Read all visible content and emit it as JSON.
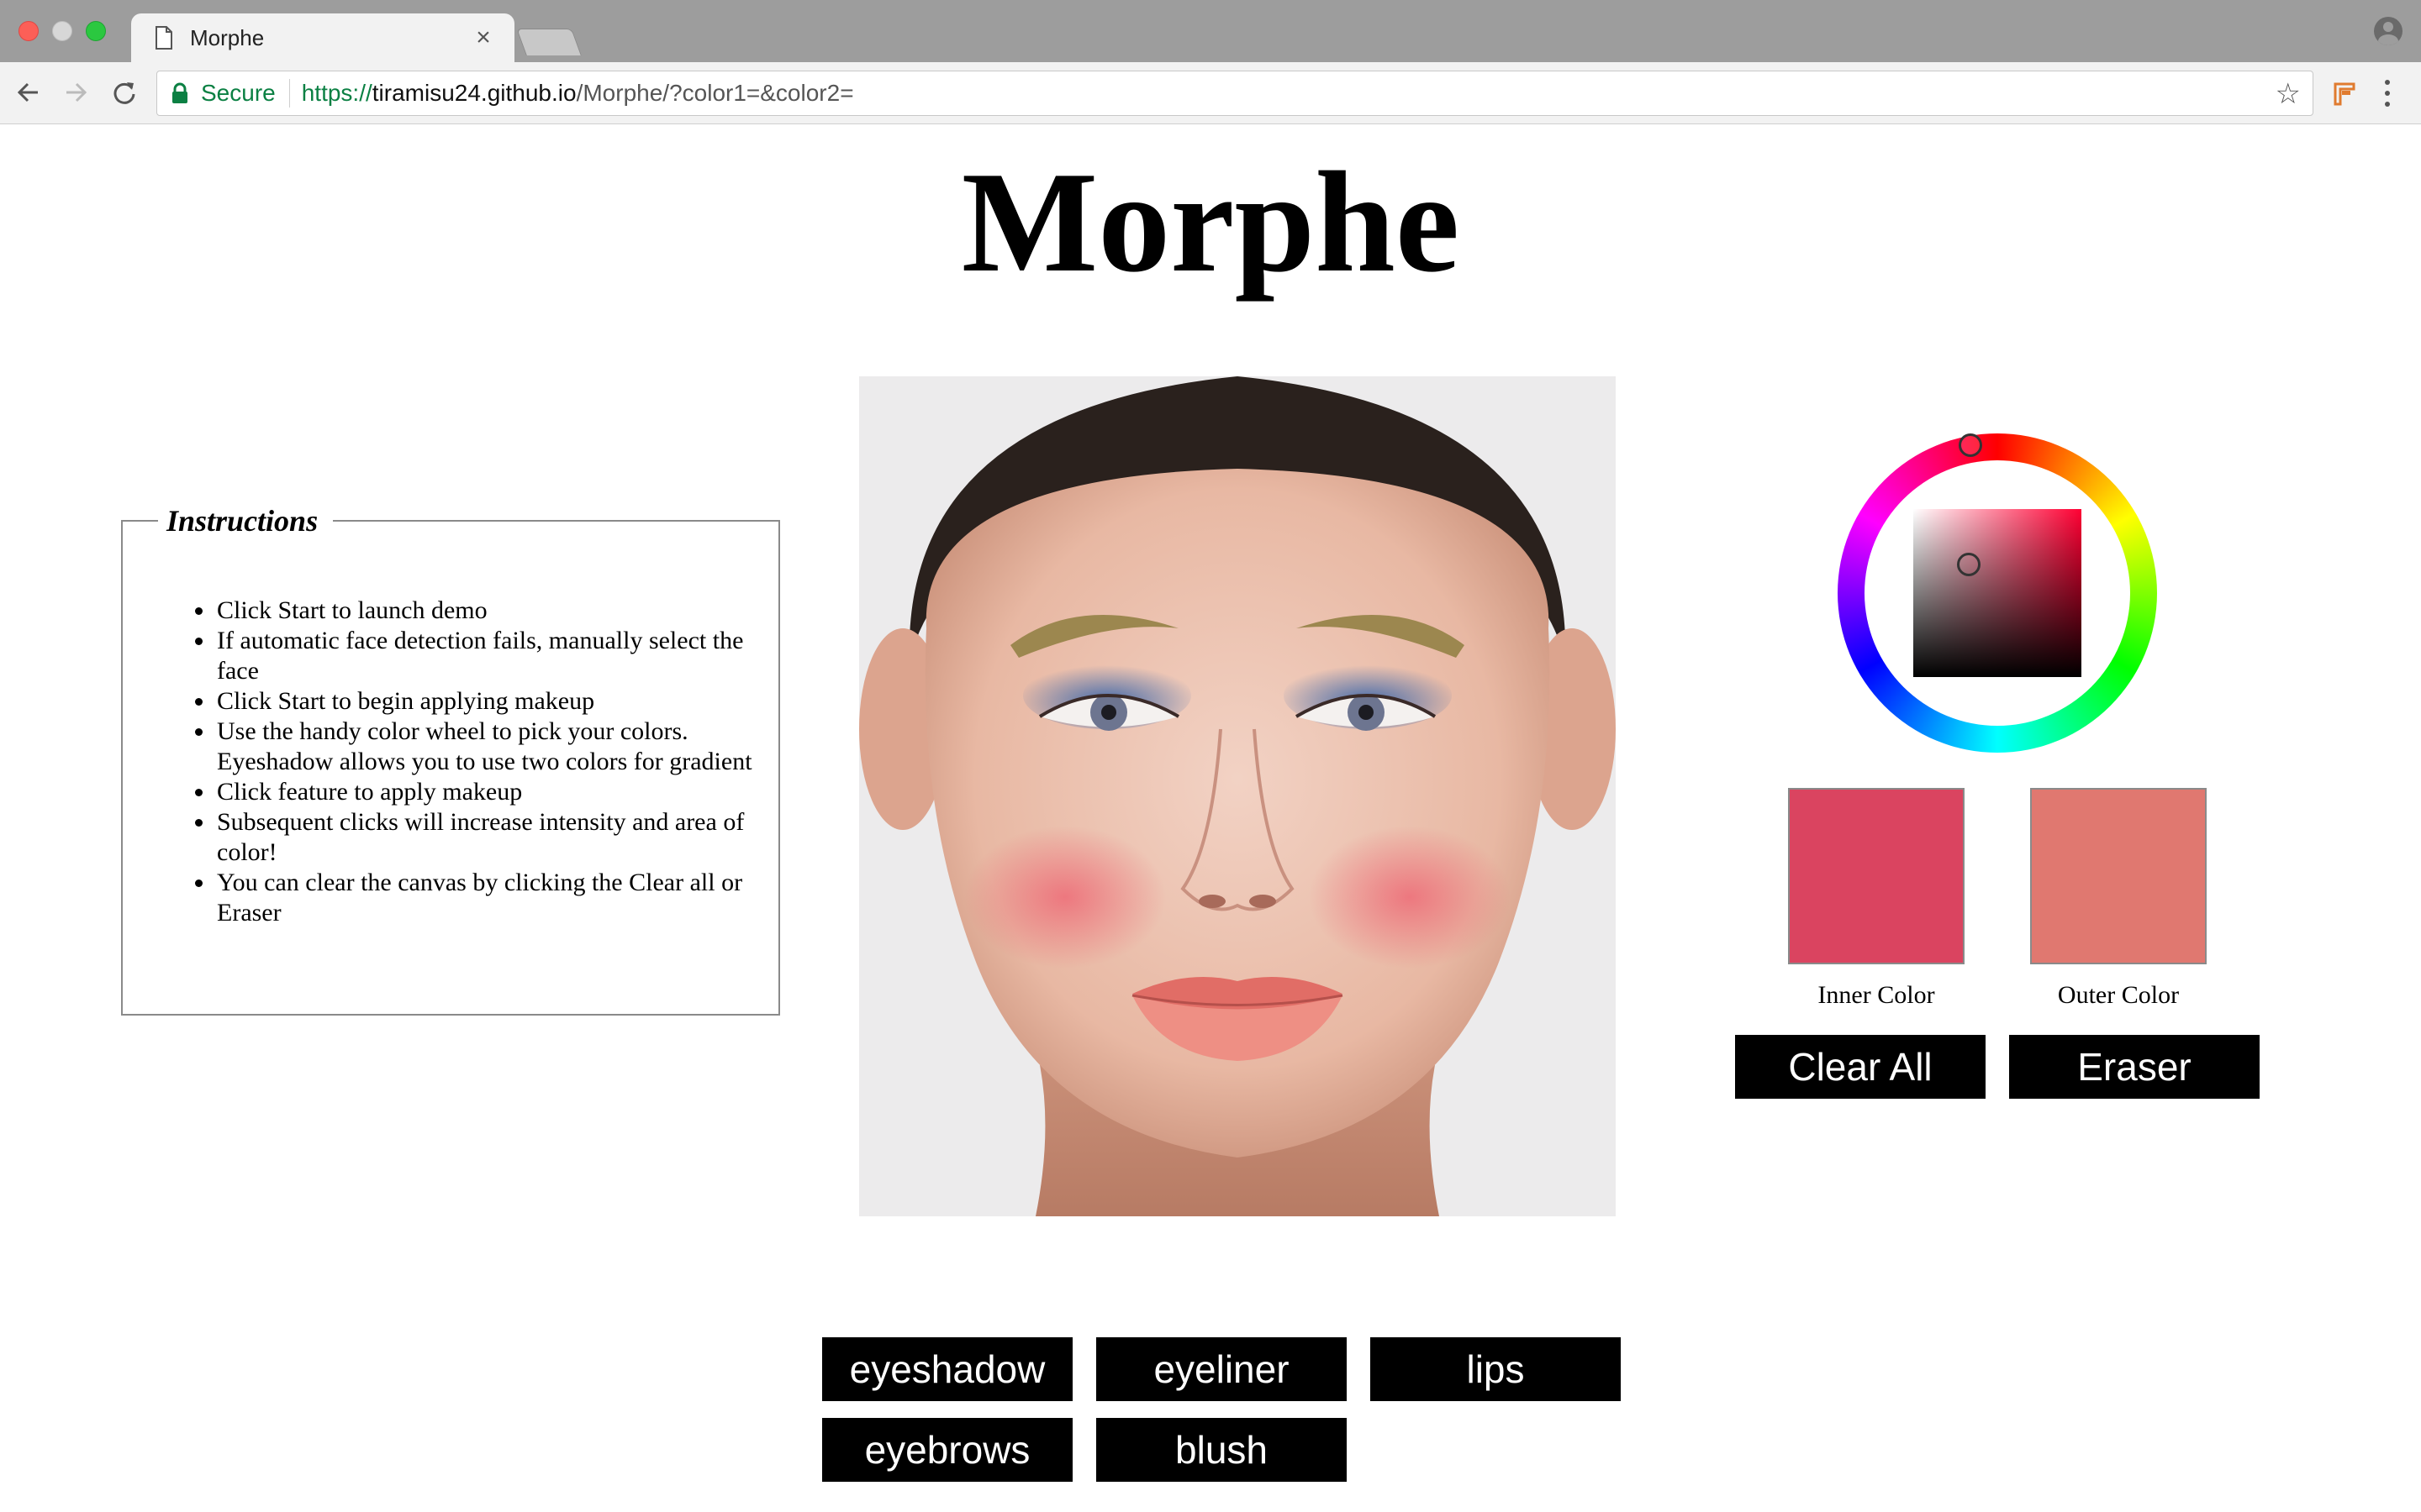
{
  "browser": {
    "tab_title": "Morphe",
    "tab_close": "×",
    "secure_label": "Secure",
    "url_scheme": "https://",
    "url_host": "tiramisu24.github.io",
    "url_path": "/Morphe/?color1=&color2=",
    "bookmark_icon": "star-icon"
  },
  "page": {
    "title": "Morphe",
    "instructions": {
      "legend": "Instructions",
      "items": [
        "Click Start to launch demo",
        "If automatic face detection fails, manually select the face",
        "Click Start to begin applying makeup",
        "Use the handy color wheel to pick your colors. Eyeshadow allows you to use two colors for gradient",
        "Click feature to apply makeup",
        "Subsequent clicks will increase intensity and area of color!",
        "You can clear the canvas by clicking the Clear all or Eraser"
      ]
    },
    "colors": {
      "inner": "#da4460",
      "outer": "#e07870",
      "inner_label": "Inner Color",
      "outer_label": "Outer Color"
    },
    "actions": {
      "clear_all": "Clear All",
      "eraser": "Eraser"
    },
    "features": {
      "eyeshadow": "eyeshadow",
      "eyeliner": "eyeliner",
      "lips": "lips",
      "eyebrows": "eyebrows",
      "blush": "blush"
    }
  }
}
